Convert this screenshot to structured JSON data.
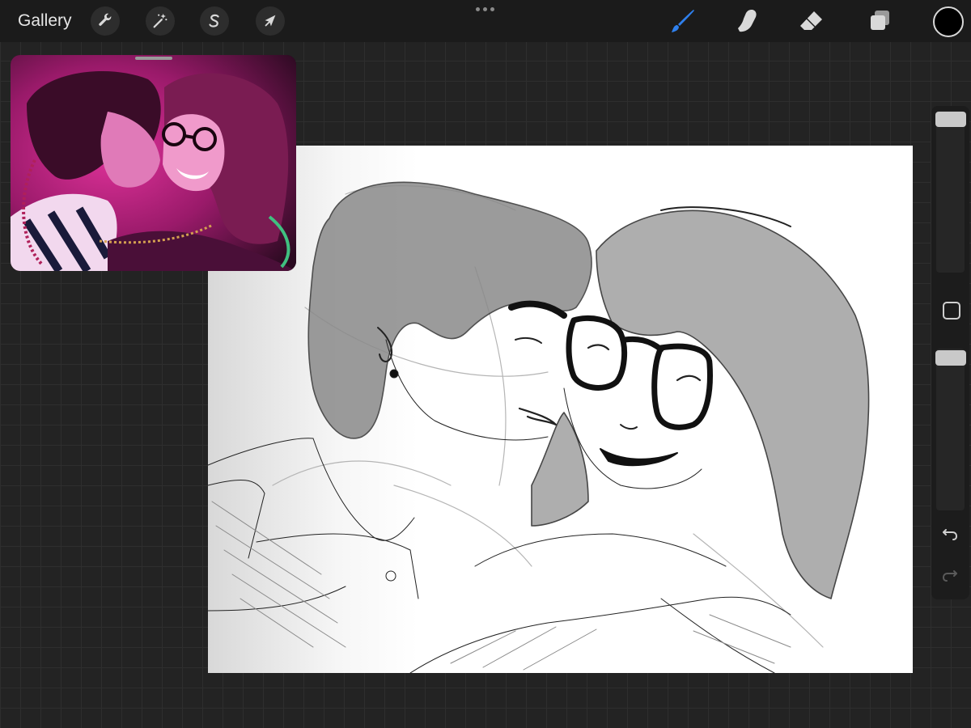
{
  "topbar": {
    "gallery_label": "Gallery",
    "tools_left": [
      {
        "name": "actions",
        "icon": "wrench-icon"
      },
      {
        "name": "adjustments",
        "icon": "magic-wand-icon"
      },
      {
        "name": "selection",
        "icon": "selection-s-icon"
      },
      {
        "name": "transform",
        "icon": "arrow-cursor-icon"
      }
    ],
    "tools_right": [
      {
        "name": "brush",
        "icon": "brush-icon",
        "active": true
      },
      {
        "name": "smudge",
        "icon": "smudge-finger-icon",
        "active": false
      },
      {
        "name": "eraser",
        "icon": "eraser-icon",
        "active": false
      },
      {
        "name": "layers",
        "icon": "layers-icon",
        "active": false
      }
    ],
    "active_tool_color": "#2f80ed",
    "current_color": "#000000"
  },
  "reference": {
    "description_icon": "reference-photo"
  },
  "sidebar": {
    "brush_size": 1.0,
    "brush_opacity": 1.0,
    "modify_icon": "square-icon",
    "undo_icon": "undo-icon",
    "redo_icon": "redo-icon"
  },
  "colors": {
    "background": "#232323",
    "toolbar": "#1b1b1b",
    "canvas": "#ffffff",
    "accent": "#2f80ed"
  }
}
